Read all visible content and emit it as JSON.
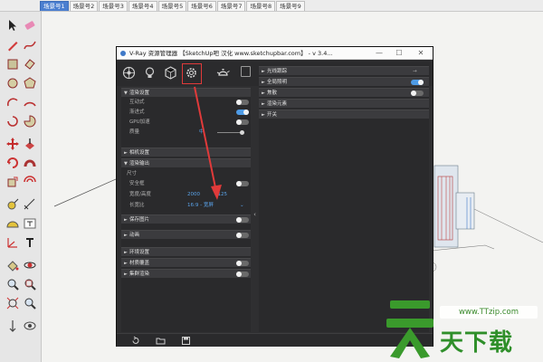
{
  "scene_tabs": [
    "场景号1",
    "场景号2",
    "场景号3",
    "场景号4",
    "场景号5",
    "场景号6",
    "场景号7",
    "场景号8",
    "场景号9"
  ],
  "active_tab_index": 0,
  "toolbar_icons": [
    "select-arrow-icon",
    "eraser-icon",
    "line-pencil-icon",
    "freehand-icon",
    "rectangle-icon",
    "rotated-rectangle-icon",
    "circle-icon",
    "polygon-icon",
    "arc-icon",
    "two-point-arc-icon",
    "three-point-arc-icon",
    "pie-icon",
    "move-icon",
    "push-pull-icon",
    "rotate-icon",
    "follow-me-icon",
    "scale-icon",
    "offset-icon",
    "tape-measure-icon",
    "dimension-icon",
    "protractor-icon",
    "text-icon",
    "axes-icon",
    "3d-text-icon",
    "paint-bucket-icon",
    "orbit-icon",
    "zoom-icon",
    "zoom-window-icon",
    "zoom-extents-icon",
    "previous-view-icon",
    "position-camera-icon",
    "look-around-icon"
  ],
  "dialog": {
    "title": "V-Ray 资源管理器 【SketchUp吧 汉化 www.sketchupbar.com】 - v 3.4...",
    "window_buttons": {
      "minimize": "—",
      "maximize": "☐",
      "close": "✕"
    },
    "icon_bar": [
      "materials-icon",
      "lights-icon",
      "geometry-icon",
      "settings-gear-icon",
      "render-teapot-icon"
    ],
    "highlighted_icon": "settings-gear-icon",
    "settings_panel": {
      "render_section": "渲染设置",
      "interactive_label": "互动式",
      "progressive_label": "渐进式",
      "progressive_on": true,
      "gpu_label": "GPU加速",
      "quality_label": "质量",
      "quality_value": "中",
      "camera_section": "相机设置",
      "output_section": "渲染输出",
      "size_label": "尺寸",
      "safe_frame_label": "安全框",
      "width_height_label": "宽度/高度",
      "width_value": "2000",
      "height_value": "1125",
      "aspect_label": "长宽比",
      "aspect_value": "16:9 - 宽屏",
      "save_image_label": "保存图片",
      "animation_label": "动画",
      "environment_section": "环境设置",
      "material_override_section": "材质覆盖",
      "swarm_section": "集群渲染"
    },
    "right_panel": {
      "raytrace_label": "光线跟踪",
      "gi_label": "全局照明",
      "gi_on": true,
      "caustics_label": "焦散",
      "render_elements_label": "渲染元素",
      "switches_label": "开关"
    },
    "footer_icons": [
      "reset-icon",
      "open-folder-icon",
      "save-icon"
    ]
  },
  "watermark": {
    "url": "www.TTzip.com",
    "text": "天下载"
  },
  "colors": {
    "active_tab": "#4b7fd0",
    "dialog_bg": "#2f2f31",
    "toggle_on": "#4e9be6",
    "annotation": "#e03a3a",
    "watermark_green": "#2f8f2a"
  }
}
